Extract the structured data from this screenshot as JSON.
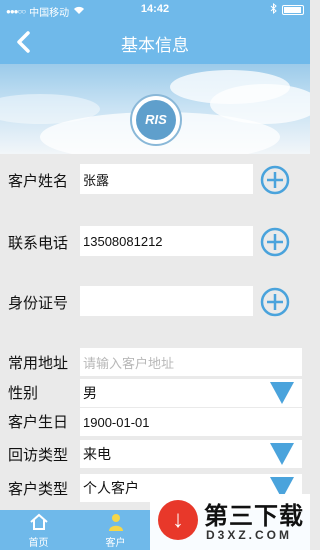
{
  "status_bar": {
    "carrier": "中国移动",
    "time": "14:42"
  },
  "nav": {
    "title": "基本信息"
  },
  "logo": {
    "text": "RIS"
  },
  "form": {
    "name_label": "客户姓名",
    "name_value": "张露",
    "phone_label": "联系电话",
    "phone_value": "13508081212",
    "id_label": "身份证号",
    "id_value": "",
    "address_label": "常用地址",
    "address_placeholder": "请输入客户地址",
    "gender_label": "性别",
    "gender_value": "男",
    "birthday_label": "客户生日",
    "birthday_value": "1900-01-01",
    "visit_type_label": "回访类型",
    "visit_type_value": "来电",
    "customer_type_label": "客户类型",
    "customer_type_value": "个人客户"
  },
  "tabs": {
    "home": "首页",
    "customer": "客户"
  },
  "watermark": {
    "title": "第三下载",
    "domain": "D3XZ.COM"
  },
  "colors": {
    "primary": "#6fb9ea",
    "accent": "#4aa3dc"
  }
}
